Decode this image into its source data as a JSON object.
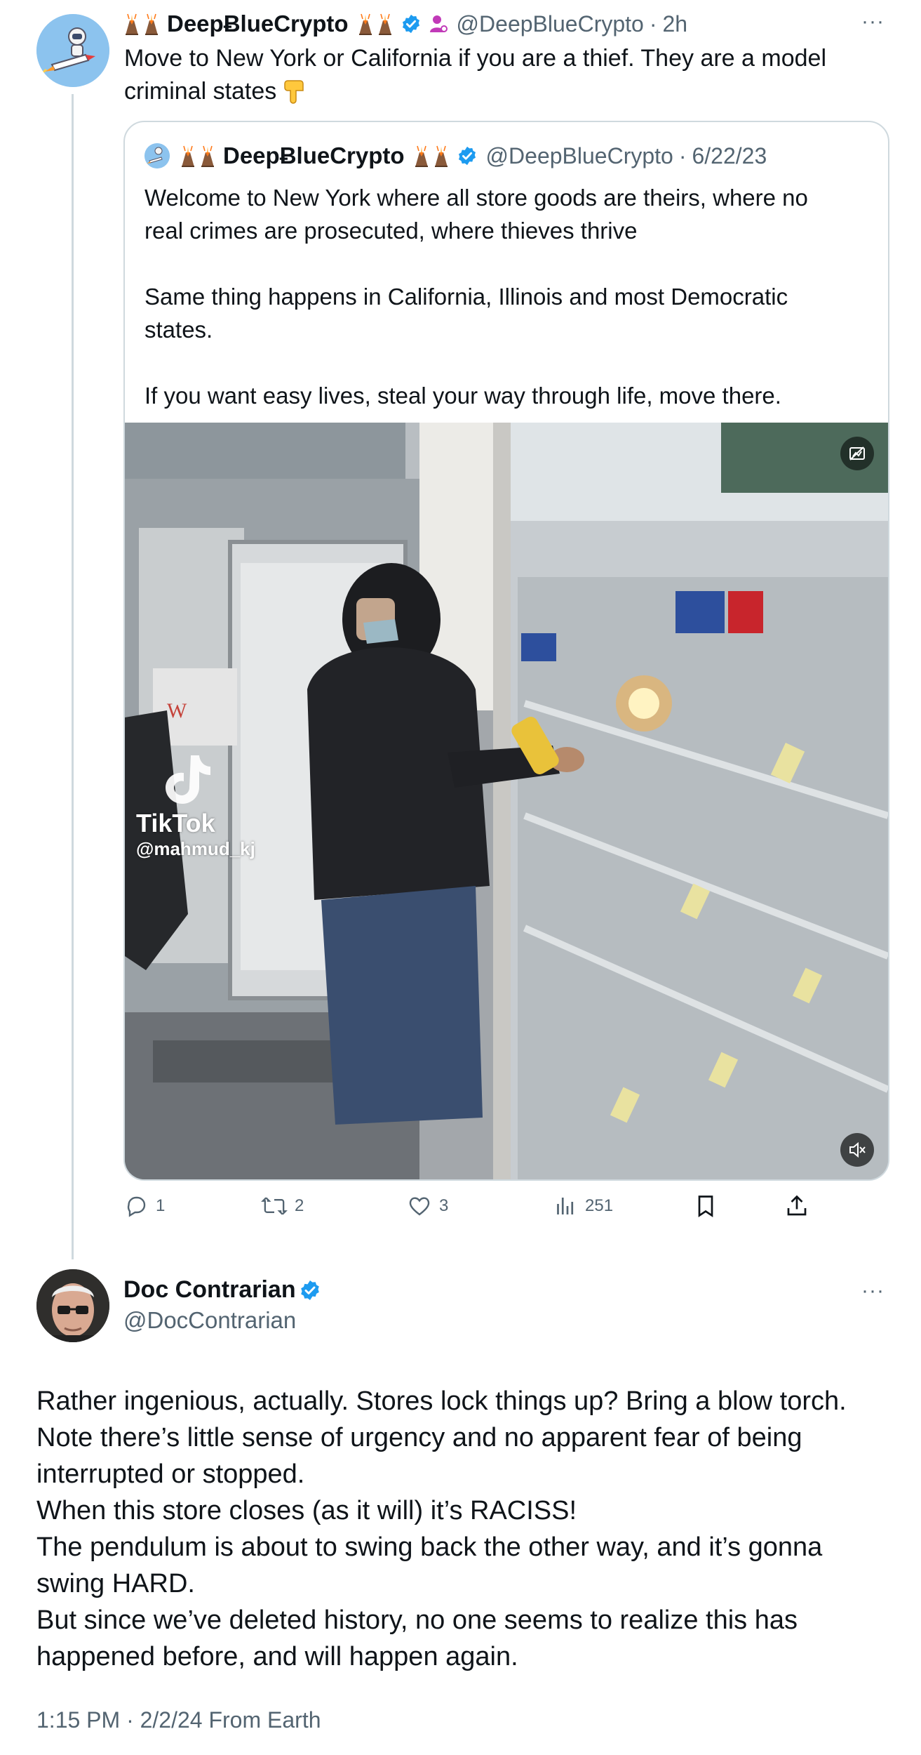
{
  "parent_tweet": {
    "display_name": "DeepɃlueCrypto",
    "handle": "@DeepBlueCrypto",
    "separator": "·",
    "time_ago": "2h",
    "text_line1": "Move to New York or California if you are a thief. They are a model",
    "text_line2": "criminal states",
    "more_icon": "more-horizontal-icon",
    "quoted": {
      "display_name": "DeepɃlueCrypto",
      "handle": "@DeepBlueCrypto",
      "separator": "·",
      "date": "6/22/23",
      "para1_line1": "Welcome to New York where all store goods are theirs, where no",
      "para1_line2": "real crimes are prosecuted, where thieves thrive",
      "para2_line1": "Same thing happens in California, Illinois and most Democratic",
      "para2_line2": "states.",
      "para3": "If you want easy lives, steal your way through life, move there.",
      "media": {
        "watermark_brand": "TikTok",
        "watermark_handle": "@mahmud_kj",
        "sticker_icon": "image-options-icon",
        "mute_icon": "muted-speaker-icon"
      }
    },
    "actions": {
      "replies": "1",
      "reposts": "2",
      "likes": "3",
      "views": "251"
    }
  },
  "main_tweet": {
    "display_name": "Doc Contrarian",
    "handle": "@DocContrarian",
    "lines": [
      "Rather ingenious, actually. Stores lock things up? Bring a blow torch.",
      "Note there’s little sense of urgency and no apparent fear of being",
      "interrupted or stopped.",
      "When this store closes (as it will) it’s RACISS!",
      "The pendulum is about to swing back the other way, and it’s gonna",
      "swing HARD.",
      "But since we’ve deleted history, no one seems to realize this has",
      "happened before, and will happen again."
    ],
    "timestamp": "1:15 PM · 2/2/24 From Earth"
  },
  "colors": {
    "verified": "#1d9bf0",
    "muted_text": "#536471",
    "border": "#cfd9de",
    "affiliate": "#c13ab8"
  }
}
